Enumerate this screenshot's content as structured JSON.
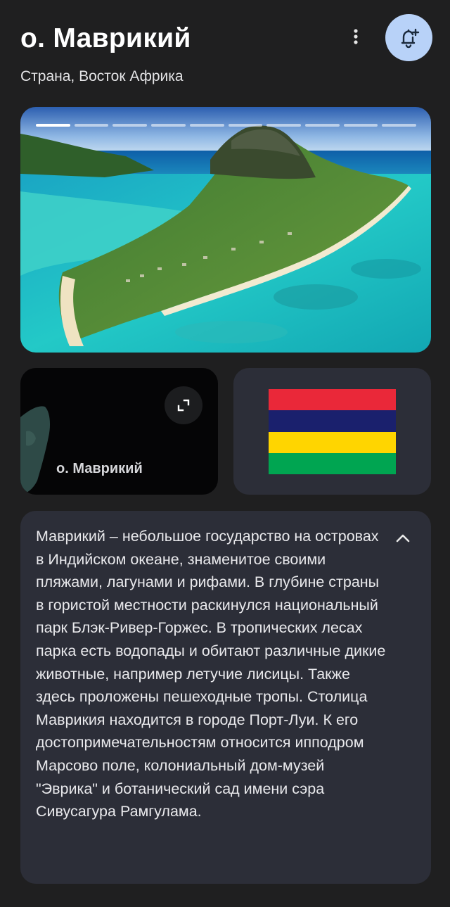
{
  "header": {
    "title": "о. Маврикий",
    "subtitle": "Страна, Восток Африка",
    "more_icon": "more-vertical-icon",
    "bell_icon": "bell-plus-icon",
    "bell_button_color": "#b8d2f8"
  },
  "gallery": {
    "image_description_icon": "mauritius-aerial-photo",
    "total_slides": 10,
    "active_slide": 1
  },
  "map_card": {
    "label": "о. Маврикий",
    "expand_icon": "expand-icon"
  },
  "flag_card": {
    "stripes": [
      "#ea2839",
      "#1a206d",
      "#ffd500",
      "#00a551"
    ]
  },
  "description": {
    "text": "Маврикий – небольшое государство на островах в Индийском океане, знаменитое своими пляжами, лагунами и рифами. В глубине страны в гористой местности раскинулся национальный парк Блэк-Ривер-Горжес. В тропических лесах парка есть водопады и обитают различные дикие животные, например летучие лисицы. Также здесь проложены пешеходные тропы. Столица Маврикия находится в городе Порт-Луи. К его достопримечательностям относится ипподром Марсово поле, колониальный дом-музей \"Эврика\" и ботанический сад имени сэра Сивусагура Рамгулама.",
    "collapse_icon": "chevron-up-icon"
  },
  "colors": {
    "background": "#1f1f20",
    "card": "#2c2e38"
  }
}
